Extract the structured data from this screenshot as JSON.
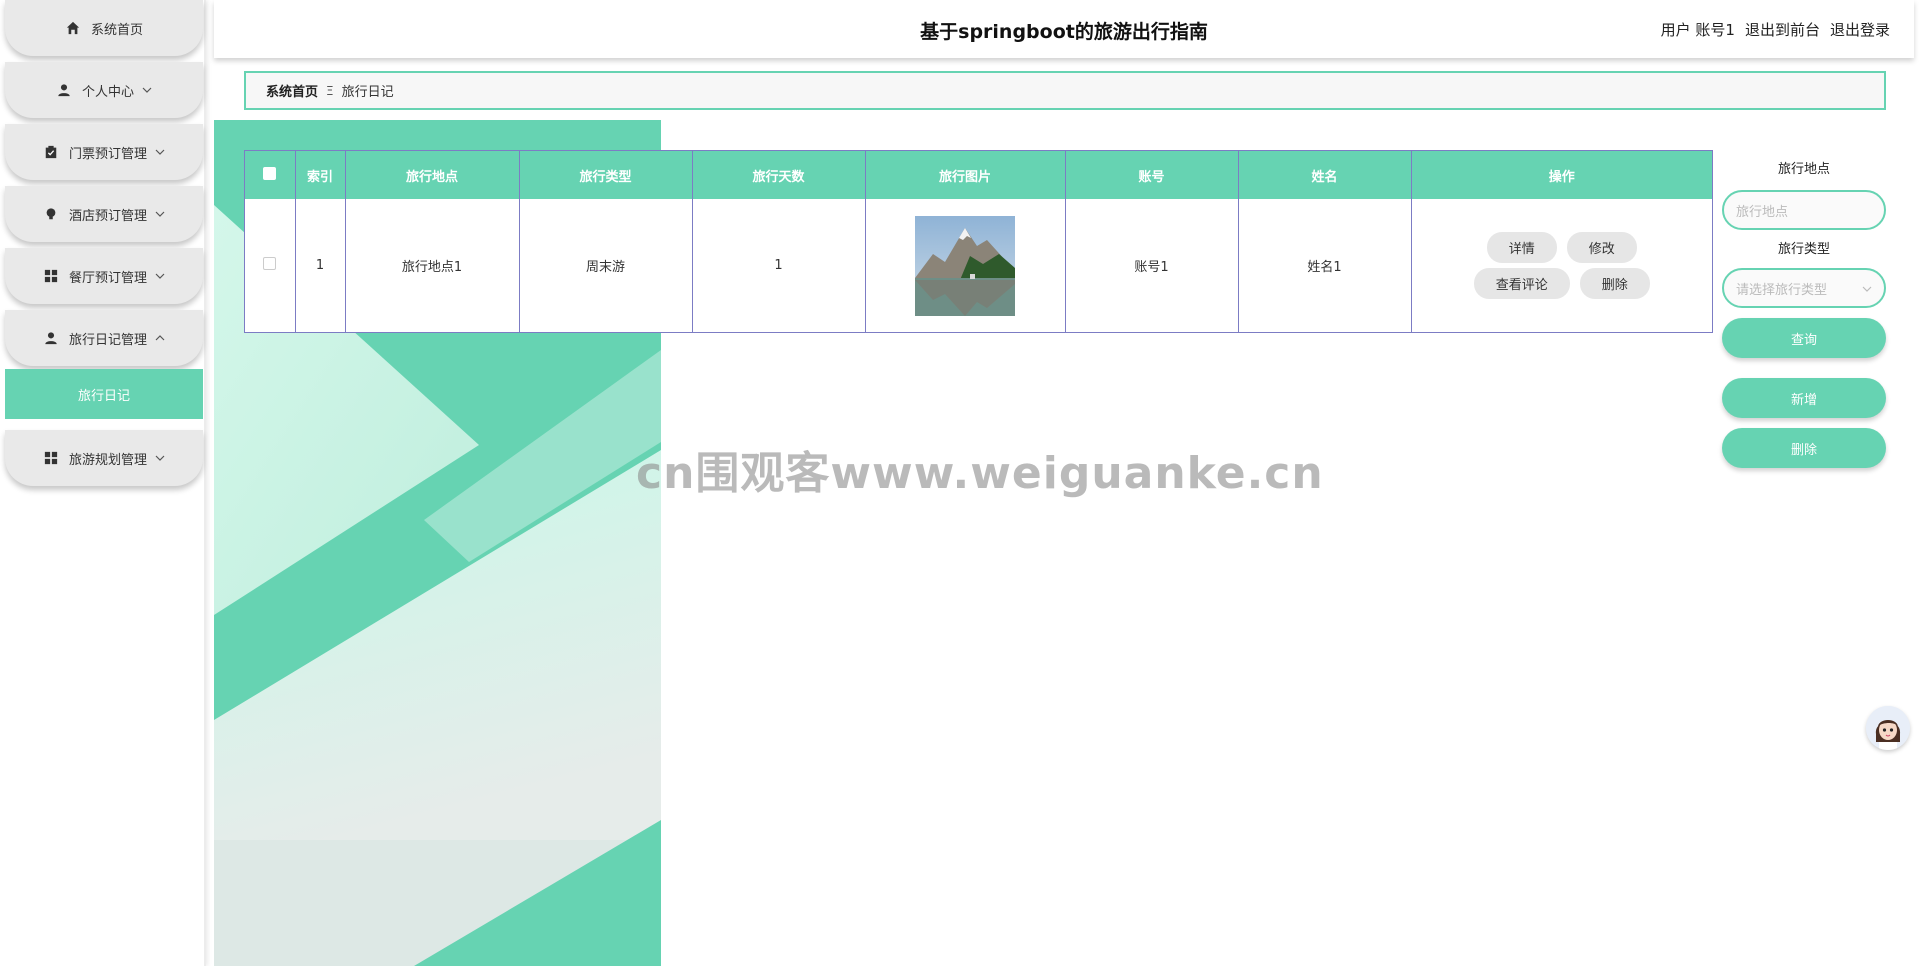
{
  "header": {
    "title": "基于springboot的旅游出行指南",
    "user_label": "用户",
    "username": "账号1",
    "to_frontend": "退出到前台",
    "logout": "退出登录"
  },
  "sidebar": {
    "items": [
      {
        "label": "系统首页",
        "icon": "home-icon"
      },
      {
        "label": "个人中心",
        "icon": "user-icon"
      },
      {
        "label": "门票预订管理",
        "icon": "clipboard-icon"
      },
      {
        "label": "酒店预订管理",
        "icon": "bulb-icon"
      },
      {
        "label": "餐厅预订管理",
        "icon": "grid-icon"
      },
      {
        "label": "旅行日记管理",
        "icon": "user-icon"
      },
      {
        "label": "旅游规划管理",
        "icon": "grid-icon"
      }
    ],
    "sub_active": "旅行日记"
  },
  "breadcrumb": {
    "home": "系统首页",
    "separator": "Ξ",
    "current": "旅行日记"
  },
  "table": {
    "columns": [
      "索引",
      "旅行地点",
      "旅行类型",
      "旅行天数",
      "旅行图片",
      "账号",
      "姓名",
      "操作"
    ],
    "rows": [
      {
        "index": "1",
        "place": "旅行地点1",
        "type": "周末游",
        "days": "1",
        "account": "账号1",
        "name": "姓名1"
      }
    ],
    "actions": {
      "detail": "详情",
      "edit": "修改",
      "comments": "查看评论",
      "delete": "删除"
    }
  },
  "search": {
    "place_label": "旅行地点",
    "place_placeholder": "旅行地点",
    "type_label": "旅行类型",
    "type_placeholder": "请选择旅行类型",
    "query_button": "查询",
    "add_button": "新增",
    "delete_button": "删除"
  },
  "watermark": "cn围观客www.weiguanke.cn",
  "colors": {
    "accent": "#66d3b2",
    "table_border": "#7c7cc4",
    "button_gray": "#e6e6e6"
  }
}
